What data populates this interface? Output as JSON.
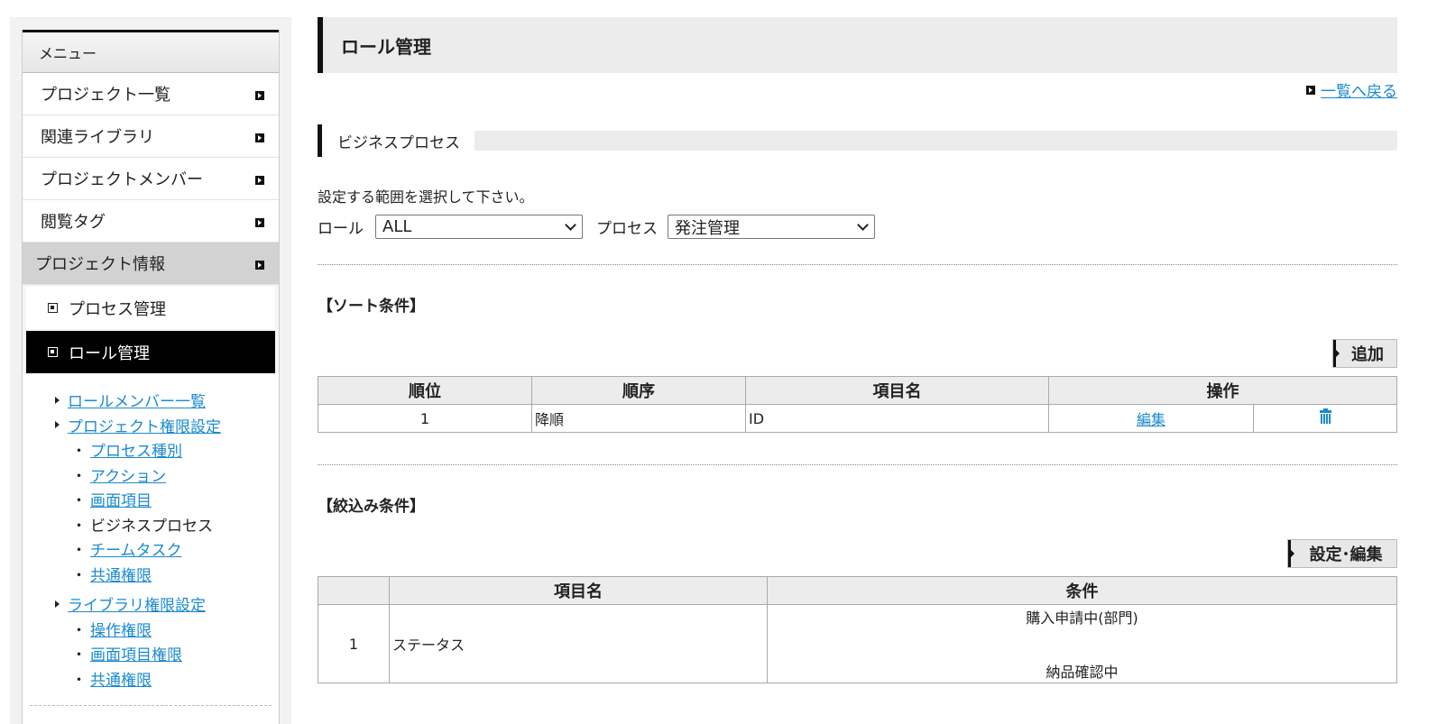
{
  "sidebar": {
    "header": "メニュー",
    "items": [
      {
        "label": "プロジェクト一覧"
      },
      {
        "label": "関連ライブラリ"
      },
      {
        "label": "プロジェクトメンバー"
      },
      {
        "label": "閲覧タグ"
      },
      {
        "label": "プロジェクト情報"
      }
    ],
    "sub_items": [
      {
        "label": "プロセス管理"
      },
      {
        "label": "ロール管理"
      }
    ],
    "links": {
      "role_members": "ロールメンバー一覧",
      "project_permissions": "プロジェクト権限設定",
      "process_type": "プロセス種別",
      "action": "アクション",
      "screen_items": "画面項目",
      "business_process": "ビジネスプロセス",
      "team_task": "チームタスク",
      "common_permissions": "共通権限",
      "library_permissions": "ライブラリ権限設定",
      "operation_permissions": "操作権限",
      "screen_item_permissions": "画面項目権限",
      "lib_common_permissions": "共通権限"
    },
    "bullet": "・"
  },
  "page": {
    "title": "ロール管理",
    "back_link": "一覧へ戻る",
    "section_title": "ビジネスプロセス",
    "instruction": "設定する範囲を選択して下さい。",
    "role_label": "ロール",
    "role_value": "ALL",
    "process_label": "プロセス",
    "process_value": "発注管理"
  },
  "sort": {
    "title": "【ソート条件】",
    "add_button": "追加",
    "headers": {
      "rank": "順位",
      "order": "順序",
      "item": "項目名",
      "op": "操作"
    },
    "rows": [
      {
        "rank": "1",
        "order": "降順",
        "item": "ID",
        "edit": "編集",
        "delete_icon": "trash-icon"
      }
    ]
  },
  "filter": {
    "title": "【絞込み条件】",
    "button": "設定･編集",
    "headers": {
      "item": "項目名",
      "condition": "条件"
    },
    "rows": [
      {
        "no": "1",
        "item": "ステータス",
        "conditions": [
          "購入申請中(部門)",
          "納品確認中"
        ]
      }
    ]
  }
}
